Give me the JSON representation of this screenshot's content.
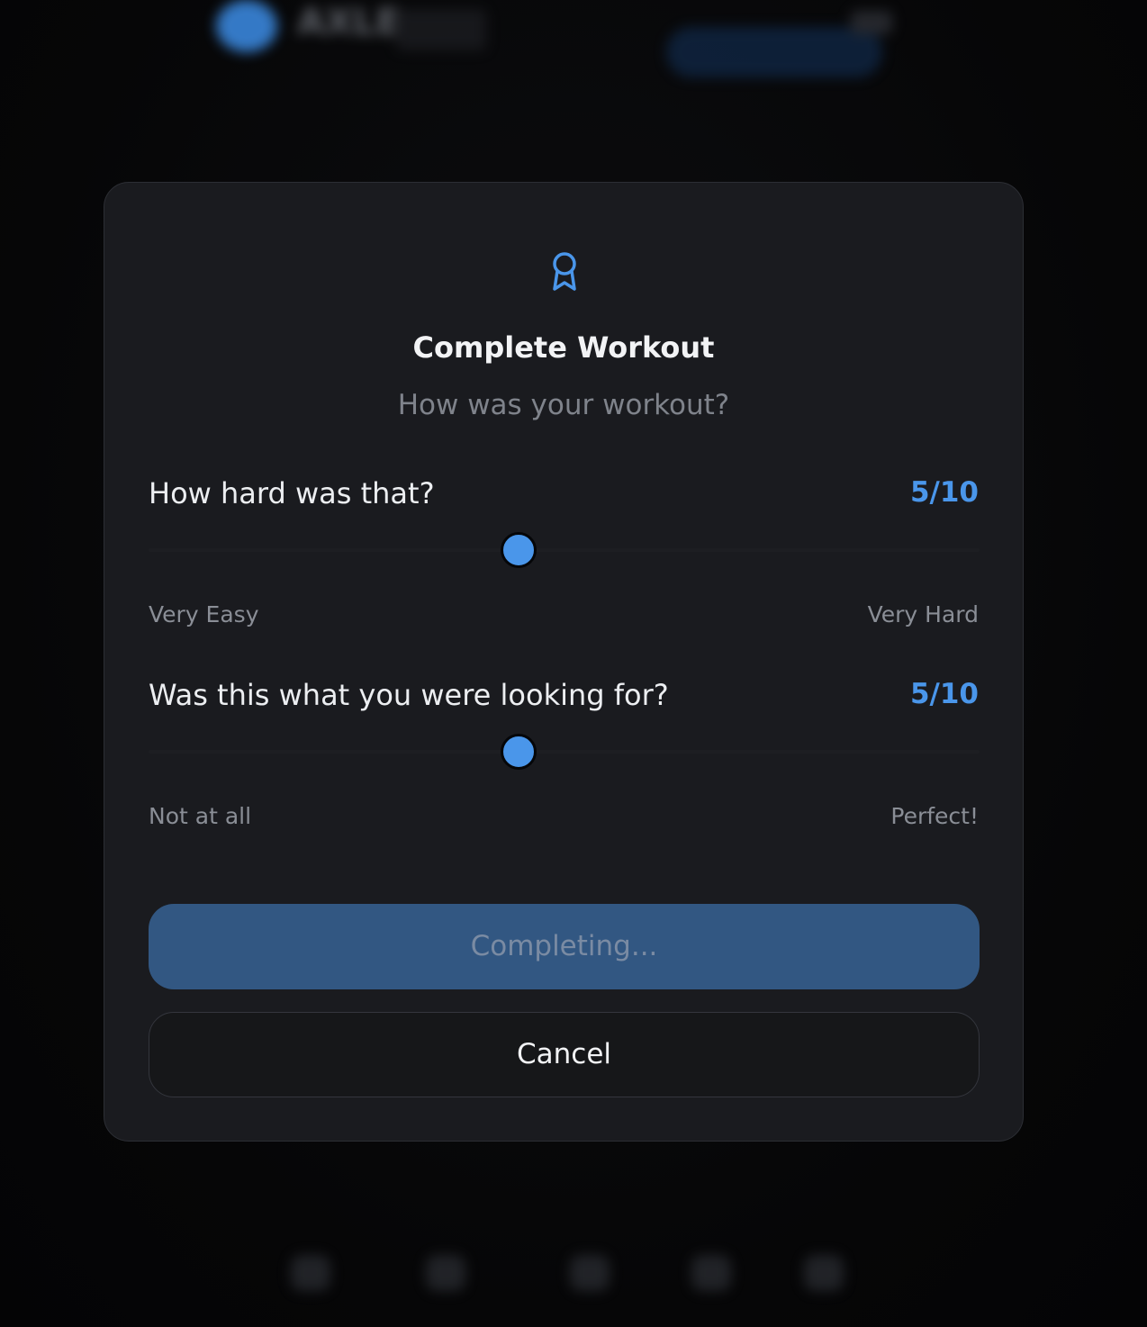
{
  "background": {
    "brand": "AXLE",
    "subtitle": "",
    "stats": [],
    "nav": []
  },
  "modal": {
    "icon": "award-icon",
    "title": "Complete Workout",
    "subtitle": "How was your workout?",
    "ratings": [
      {
        "question": "How hard was that?",
        "value": 5,
        "max": 10,
        "display": "5/10",
        "min_label": "Very Easy",
        "max_label": "Very Hard"
      },
      {
        "question": "Was this what you were looking for?",
        "value": 5,
        "max": 10,
        "display": "5/10",
        "min_label": "Not at all",
        "max_label": "Perfect!"
      }
    ],
    "complete_label": "Completing...",
    "cancel_label": "Cancel"
  },
  "colors": {
    "accent": "#4a96ea",
    "modal_bg": "#1a1b1f",
    "complete_button_bg": "#325782"
  }
}
